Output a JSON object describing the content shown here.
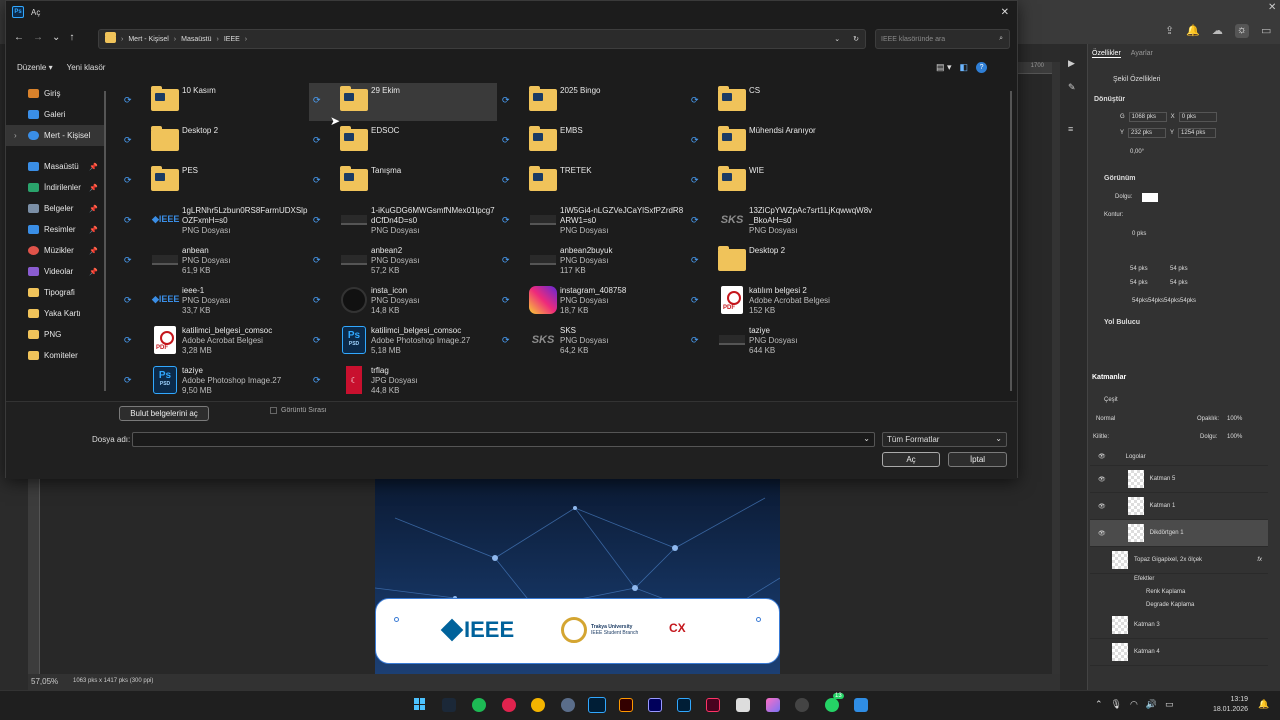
{
  "dialog": {
    "title": "Aç",
    "app_badge": "Ps",
    "close_glyph": "✕",
    "breadcrumb": [
      "Mert - Kişisel",
      "Masaüstü",
      "IEEE"
    ],
    "search_placeholder": "IEEE klasöründe ara",
    "toolbar": {
      "organize": "Düzenle",
      "new_folder": "Yeni klasör"
    },
    "nav": [
      {
        "label": "Giriş",
        "icon": "home-icon",
        "color": "#d9822b"
      },
      {
        "label": "Galeri",
        "icon": "gallery-icon",
        "color": "#3a8ee6"
      },
      {
        "label": "Mert - Kişisel",
        "icon": "cloud-icon",
        "color": "#3a8ee6",
        "selected": true
      },
      {
        "label": "Masaüstü",
        "icon": "desktop-icon",
        "color": "#3a8ee6",
        "pinned": true
      },
      {
        "label": "İndirilenler",
        "icon": "download-icon",
        "color": "#2aa36b",
        "pinned": true
      },
      {
        "label": "Belgeler",
        "icon": "documents-icon",
        "color": "#7b8fa6",
        "pinned": true
      },
      {
        "label": "Resimler",
        "icon": "pictures-icon",
        "color": "#3a8ee6",
        "pinned": true
      },
      {
        "label": "Müzikler",
        "icon": "music-icon",
        "color": "#e0534a",
        "pinned": true
      },
      {
        "label": "Videolar",
        "icon": "videos-icon",
        "color": "#8a5cd1",
        "pinned": true
      },
      {
        "label": "Tipografi",
        "icon": "folder-icon",
        "color": "#f0c35a"
      },
      {
        "label": "Yaka Kartı",
        "icon": "folder-icon",
        "color": "#f0c35a"
      },
      {
        "label": "PNG",
        "icon": "folder-icon",
        "color": "#f0c35a"
      },
      {
        "label": "Komiteler",
        "icon": "folder-icon",
        "color": "#f0c35a"
      }
    ],
    "files": [
      {
        "name": "10 Kasım",
        "type": "",
        "size": "",
        "kind": "folder"
      },
      {
        "name": "29 Ekim",
        "type": "",
        "size": "",
        "kind": "folder",
        "hover": true
      },
      {
        "name": "2025 Bingo",
        "type": "",
        "size": "",
        "kind": "folder"
      },
      {
        "name": "CS",
        "type": "",
        "size": "",
        "kind": "folder"
      },
      {
        "name": "Desktop 2",
        "type": "",
        "size": "",
        "kind": "folder-plain"
      },
      {
        "name": "EDSOC",
        "type": "",
        "size": "",
        "kind": "folder"
      },
      {
        "name": "EMBS",
        "type": "",
        "size": "",
        "kind": "folder"
      },
      {
        "name": "Mühendsi Aranıyor",
        "type": "",
        "size": "",
        "kind": "folder"
      },
      {
        "name": "PES",
        "type": "",
        "size": "",
        "kind": "folder"
      },
      {
        "name": "Tanışma",
        "type": "",
        "size": "",
        "kind": "folder"
      },
      {
        "name": "TRETEK",
        "type": "",
        "size": "",
        "kind": "folder"
      },
      {
        "name": "WIE",
        "type": "",
        "size": "",
        "kind": "folder"
      },
      {
        "name": "1gLRNhr5Lzbun0RS8FarmUDXSlpOZFxmH=s0",
        "type": "PNG Dosyası",
        "size": "",
        "kind": "ieee"
      },
      {
        "name": "1-iKuGDG6MWGsmfNMex01lpcg7dCfDn4D=s0",
        "type": "PNG Dosyası",
        "size": "",
        "kind": "dark"
      },
      {
        "name": "1iW5Gi4-nLGZVeJCaYlSxfPZrdR8ARW1=s0",
        "type": "PNG Dosyası",
        "size": "",
        "kind": "dark"
      },
      {
        "name": "13ZiCpYWZpAc7srt1LjKqwwqW8v_BkoAH=s0",
        "type": "PNG Dosyası",
        "size": "",
        "kind": "sks"
      },
      {
        "name": "anbean",
        "type": "PNG Dosyası",
        "size": "61,9 KB",
        "kind": "dark"
      },
      {
        "name": "anbean2",
        "type": "PNG Dosyası",
        "size": "57,2 KB",
        "kind": "dark"
      },
      {
        "name": "anbean2buyuk",
        "type": "PNG Dosyası",
        "size": "117 KB",
        "kind": "dark"
      },
      {
        "name": "Desktop 2",
        "type": "",
        "size": "",
        "kind": "folder-plain"
      },
      {
        "name": "ieee-1",
        "type": "PNG Dosyası",
        "size": "33,7 KB",
        "kind": "ieee"
      },
      {
        "name": "insta_icon",
        "type": "PNG Dosyası",
        "size": "14,8 KB",
        "kind": "insta-dark"
      },
      {
        "name": "instagram_408758",
        "type": "PNG Dosyası",
        "size": "18,7 KB",
        "kind": "insta"
      },
      {
        "name": "katılım belgesi 2",
        "type": "Adobe Acrobat Belgesi",
        "size": "152 KB",
        "kind": "pdf"
      },
      {
        "name": "katilimci_belgesi_comsoc",
        "type": "Adobe Acrobat Belgesi",
        "size": "3,28 MB",
        "kind": "pdf"
      },
      {
        "name": "katilimci_belgesi_comsoc",
        "type": "Adobe Photoshop Image.27",
        "size": "5,18 MB",
        "kind": "psd"
      },
      {
        "name": "SKS",
        "type": "PNG Dosyası",
        "size": "64,2 KB",
        "kind": "sks"
      },
      {
        "name": "taziye",
        "type": "PNG Dosyası",
        "size": "644 KB",
        "kind": "dark"
      },
      {
        "name": "taziye",
        "type": "Adobe Photoshop Image.27",
        "size": "9,50 MB",
        "kind": "psd"
      },
      {
        "name": "trflag",
        "type": "JPG Dosyası",
        "size": "44,8 KB",
        "kind": "flag"
      }
    ],
    "cloud_button": "Bulut belgelerini aç",
    "preview_label": "Görüntü Sırası",
    "filename_label": "Dosya adı:",
    "filename_value": "",
    "filter_value": "Tüm Formatlar",
    "open_button": "Aç",
    "cancel_button": "İptal"
  },
  "photoshop": {
    "status_zoom": "57,05%",
    "status_doc": "1063 pks x 1417 pks (300 ppi)",
    "ruler_marks": [
      "1700"
    ],
    "tabs": [
      "Özellikler",
      "Ayarlar"
    ],
    "props_subtitle": "Şekil Özellikleri",
    "transform_header": "Dönüştür",
    "W": "1068 pks",
    "X": "0 pks",
    "H": "232 pks",
    "Y": "1254 pks",
    "angle": "0,00°",
    "appearance_header": "Görünüm",
    "fill_label": "Dolgu:",
    "stroke_label": "Kontur:",
    "stroke_width": "0 pks",
    "corners": [
      "54 pks",
      "54 pks",
      "54 pks",
      "54 pks"
    ],
    "corners_combined": "54pks54pks54pks54pks",
    "path_header": "Yol Bulucu",
    "layers_header": "Katmanlar",
    "kind_label": "Çeşit",
    "blend_mode": "Normal",
    "opacity_label": "Opaklık:",
    "opacity": "100%",
    "lock_label": "Kilitle:",
    "fill2_label": "Dolgu:",
    "fill2": "100%",
    "layers": [
      {
        "name": "Logolar",
        "group": true
      },
      {
        "name": "Katman 5"
      },
      {
        "name": "Katman 1"
      },
      {
        "name": "Dikdörtgen 1",
        "selected": true
      },
      {
        "name": "Topaz Gigapixel, 2x ölçek",
        "fx": "fx"
      },
      {
        "name": "Efektler",
        "sub": true
      },
      {
        "name": "Renk Kaplama",
        "sub": true
      },
      {
        "name": "Degrade Kaplama",
        "sub": true
      },
      {
        "name": "Katman 3"
      },
      {
        "name": "Katman 4"
      }
    ],
    "doc_logo_ieee": "IEEE",
    "doc_logo_tu": "Trakya University",
    "doc_logo_tu_sub": "IEEE Student Branch"
  },
  "taskbar": {
    "time": "13:19",
    "date": "18.01.2026",
    "badge": "13"
  }
}
